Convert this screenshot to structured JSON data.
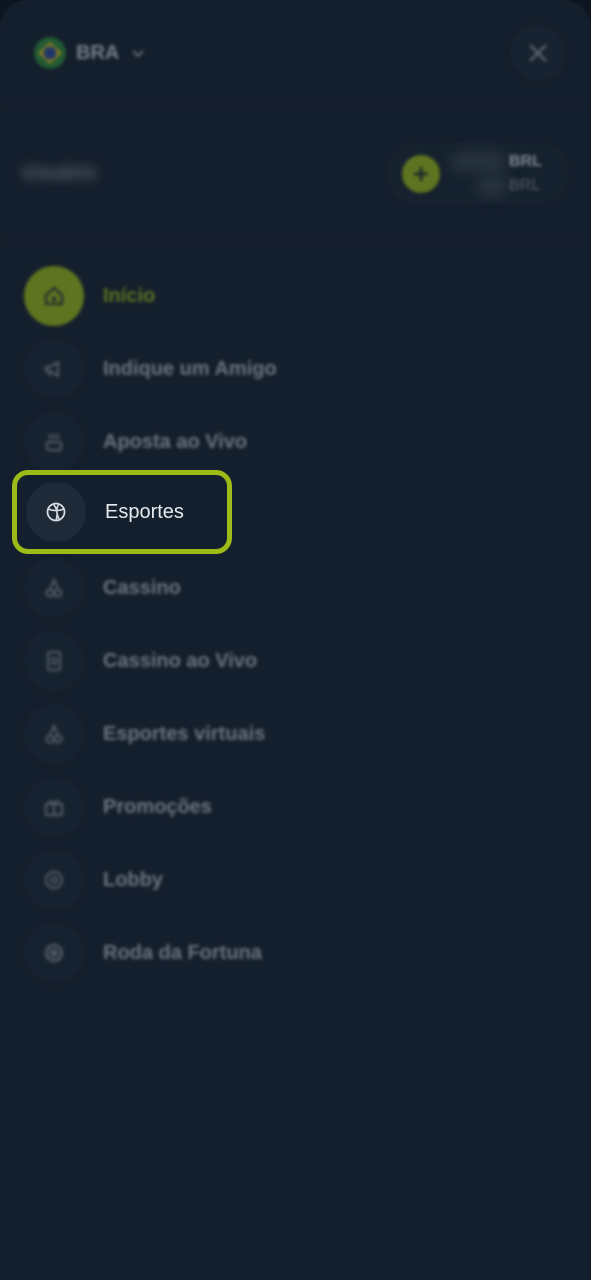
{
  "header": {
    "country_code": "BRA",
    "flag_icon": "brazil-flag-icon",
    "dropdown_icon": "chevron-down-icon",
    "close_icon": "close-icon"
  },
  "account": {
    "username": "Usuário",
    "balance_currency": "BRL",
    "bonus_currency": "BRL",
    "add_icon": "plus-icon"
  },
  "menu": {
    "items": [
      {
        "label": "Início",
        "icon": "home-icon"
      },
      {
        "label": "Indique um Amigo",
        "icon": "megaphone-icon"
      },
      {
        "label": "Aposta ao Vivo",
        "icon": "live-bet-icon"
      },
      {
        "label": "Esportes",
        "icon": "basketball-icon"
      },
      {
        "label": "Cassino",
        "icon": "cherries-icon"
      },
      {
        "label": "Cassino ao Vivo",
        "icon": "playing-card-icon"
      },
      {
        "label": "Esportes virtuais",
        "icon": "cherries-icon"
      },
      {
        "label": "Promoções",
        "icon": "gift-icon"
      },
      {
        "label": "Lobby",
        "icon": "chip-icon"
      },
      {
        "label": "Roda da Fortuna",
        "icon": "wheel-icon"
      }
    ]
  },
  "colors": {
    "accent": "#9dbb16",
    "background": "#141f2d",
    "highlight_border": "#9dbb16"
  }
}
